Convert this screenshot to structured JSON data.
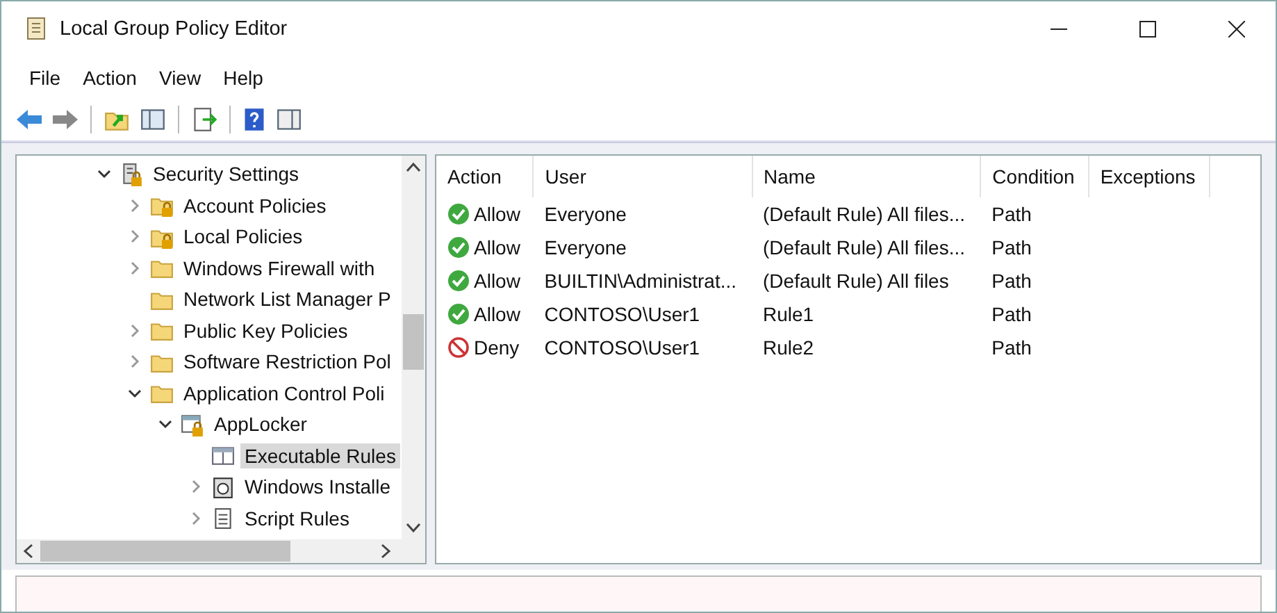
{
  "window": {
    "title": "Local Group Policy Editor"
  },
  "menu": [
    "File",
    "Action",
    "View",
    "Help"
  ],
  "tree": [
    {
      "label": "Security Settings",
      "kind": "security",
      "expanded": true,
      "selected": false,
      "children": [
        {
          "label": "Account Policies",
          "kind": "locked-folder",
          "expanded": false,
          "selected": false
        },
        {
          "label": "Local Policies",
          "kind": "locked-folder",
          "expanded": false,
          "selected": false
        },
        {
          "label": "Windows Firewall with",
          "kind": "folder",
          "expanded": false,
          "selected": false
        },
        {
          "label": "Network List Manager P",
          "kind": "folder",
          "selected": false
        },
        {
          "label": "Public Key Policies",
          "kind": "folder",
          "expanded": false,
          "selected": false
        },
        {
          "label": "Software Restriction Pol",
          "kind": "folder",
          "expanded": false,
          "selected": false
        },
        {
          "label": "Application Control Poli",
          "kind": "folder",
          "expanded": true,
          "selected": false,
          "children": [
            {
              "label": "AppLocker",
              "kind": "applocker",
              "expanded": true,
              "selected": false,
              "children": [
                {
                  "label": "Executable Rules",
                  "kind": "rules",
                  "selected": true
                },
                {
                  "label": "Windows Installe",
                  "kind": "installer",
                  "expanded": false,
                  "selected": false
                },
                {
                  "label": "Script Rules",
                  "kind": "script",
                  "expanded": false,
                  "selected": false
                }
              ]
            }
          ]
        }
      ]
    }
  ],
  "table": {
    "columns": [
      "Action",
      "User",
      "Name",
      "Condition",
      "Exceptions"
    ],
    "rows": [
      {
        "kind": "allow",
        "action": "Allow",
        "user": "Everyone",
        "name": "(Default Rule) All files...",
        "condition": "Path"
      },
      {
        "kind": "allow",
        "action": "Allow",
        "user": "Everyone",
        "name": "(Default Rule) All files...",
        "condition": "Path"
      },
      {
        "kind": "allow",
        "action": "Allow",
        "user": "BUILTIN\\Administrat...",
        "name": "(Default Rule) All files",
        "condition": "Path"
      },
      {
        "kind": "allow",
        "action": "Allow",
        "user": "CONTOSO\\User1",
        "name": "Rule1",
        "condition": "Path"
      },
      {
        "kind": "deny",
        "action": "Deny",
        "user": "CONTOSO\\User1",
        "name": "Rule2",
        "condition": "Path"
      }
    ]
  }
}
